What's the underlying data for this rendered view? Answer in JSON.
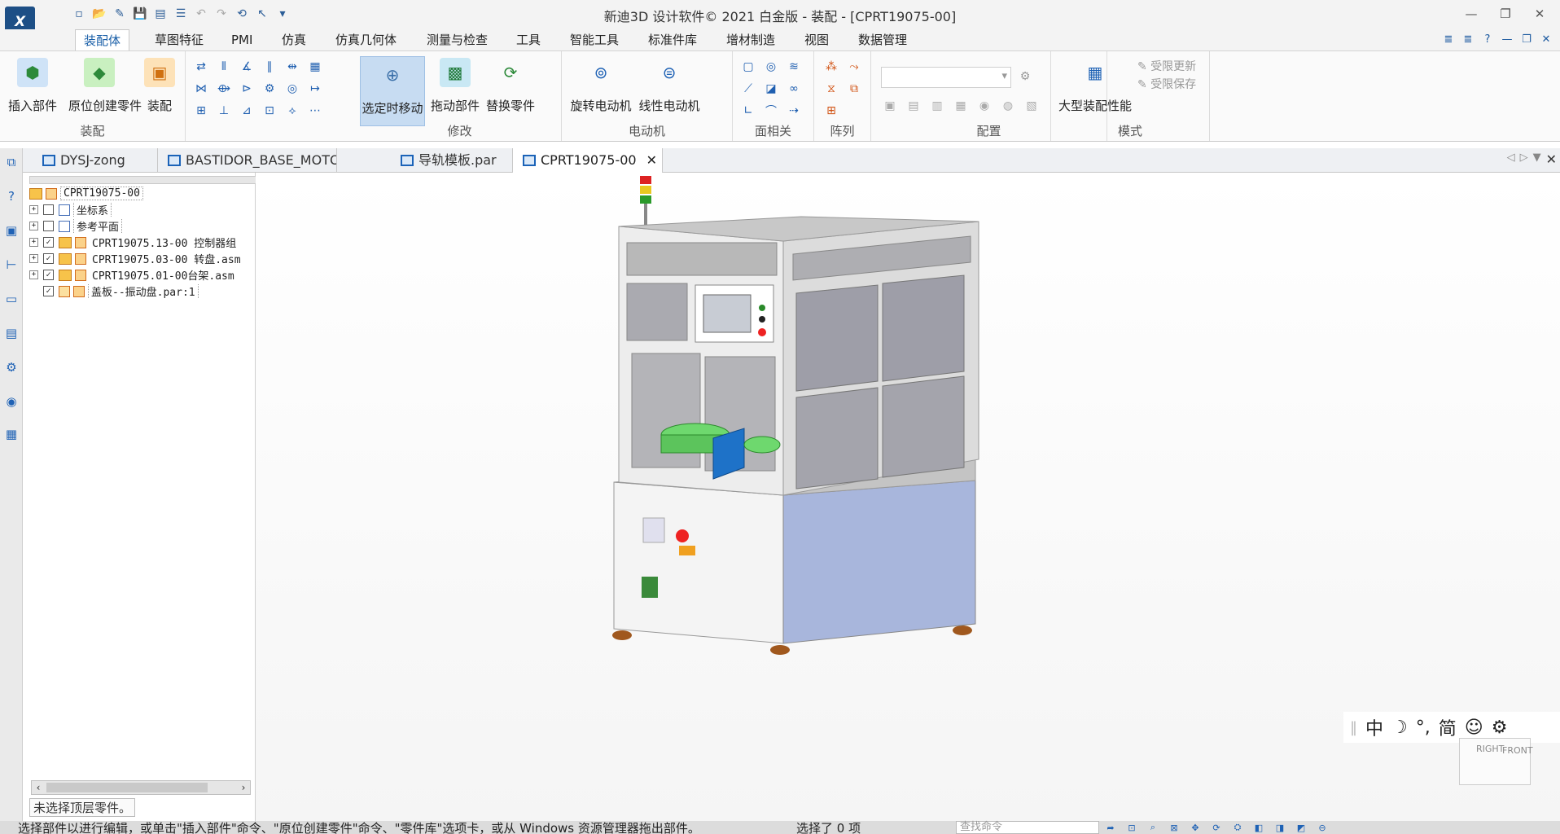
{
  "window": {
    "title": "新迪3D 设计软件© 2021 白金版 - 装配 - [CPRT19075-00]",
    "logo": "X"
  },
  "ribbon_tabs": [
    "装配体",
    "草图特征",
    "PMI",
    "仿真",
    "仿真几何体",
    "测量与检查",
    "工具",
    "智能工具",
    "标准件库",
    "增材制造",
    "视图",
    "数据管理"
  ],
  "ribbon": {
    "assembly": {
      "group": "装配",
      "insert": "插入部件",
      "in_place": "原位创建零件",
      "assemble": "装配"
    },
    "modify": {
      "group": "修改",
      "move_on_select": "选定时移动",
      "drag": "拖动部件",
      "replace": "替换零件"
    },
    "motor": {
      "group": "电动机",
      "rotary": "旋转电动机",
      "linear": "线性电动机"
    },
    "face": {
      "group": "面相关"
    },
    "pattern": {
      "group": "阵列"
    },
    "config": {
      "group": "配置"
    },
    "modes": {
      "group": "模式",
      "large": "大型装配性能",
      "limited_update": "受限更新",
      "limited_save": "受限保存"
    }
  },
  "doc_tabs": [
    {
      "label": "DYSJ-zong"
    },
    {
      "label": "BASTIDOR_BASE_MOTO_..."
    },
    {
      "label": "导轨模板.par"
    },
    {
      "label": "CPRT19075-00",
      "close": "✕"
    }
  ],
  "tree": {
    "root": "CPRT19075-00",
    "items": [
      {
        "label": "坐标系"
      },
      {
        "label": "参考平面"
      },
      {
        "label": "CPRT19075.13-00 控制器组"
      },
      {
        "label": "CPRT19075.03-00 转盘.asm"
      },
      {
        "label": "CPRT19075.01-00台架.asm"
      },
      {
        "label": "盖板--振动盘.par:1"
      }
    ],
    "hint": "未选择顶层零件。"
  },
  "ime": [
    "中",
    "☽",
    "°,",
    "简",
    "☺",
    "⚙"
  ],
  "cube_labels": {
    "front": "FRONT",
    "right": "RIGHT"
  },
  "status": {
    "message": "选择部件以进行编辑，或单击\"插入部件\"命令、\"原位创建零件\"命令、\"零件库\"选项卡，或从 Windows 资源管理器拖出部件。",
    "selection": "选择了 0 项",
    "find_placeholder": "查找命令"
  },
  "colors": {
    "accent": "#1a5fa8",
    "selected": "#c7dcf2"
  }
}
